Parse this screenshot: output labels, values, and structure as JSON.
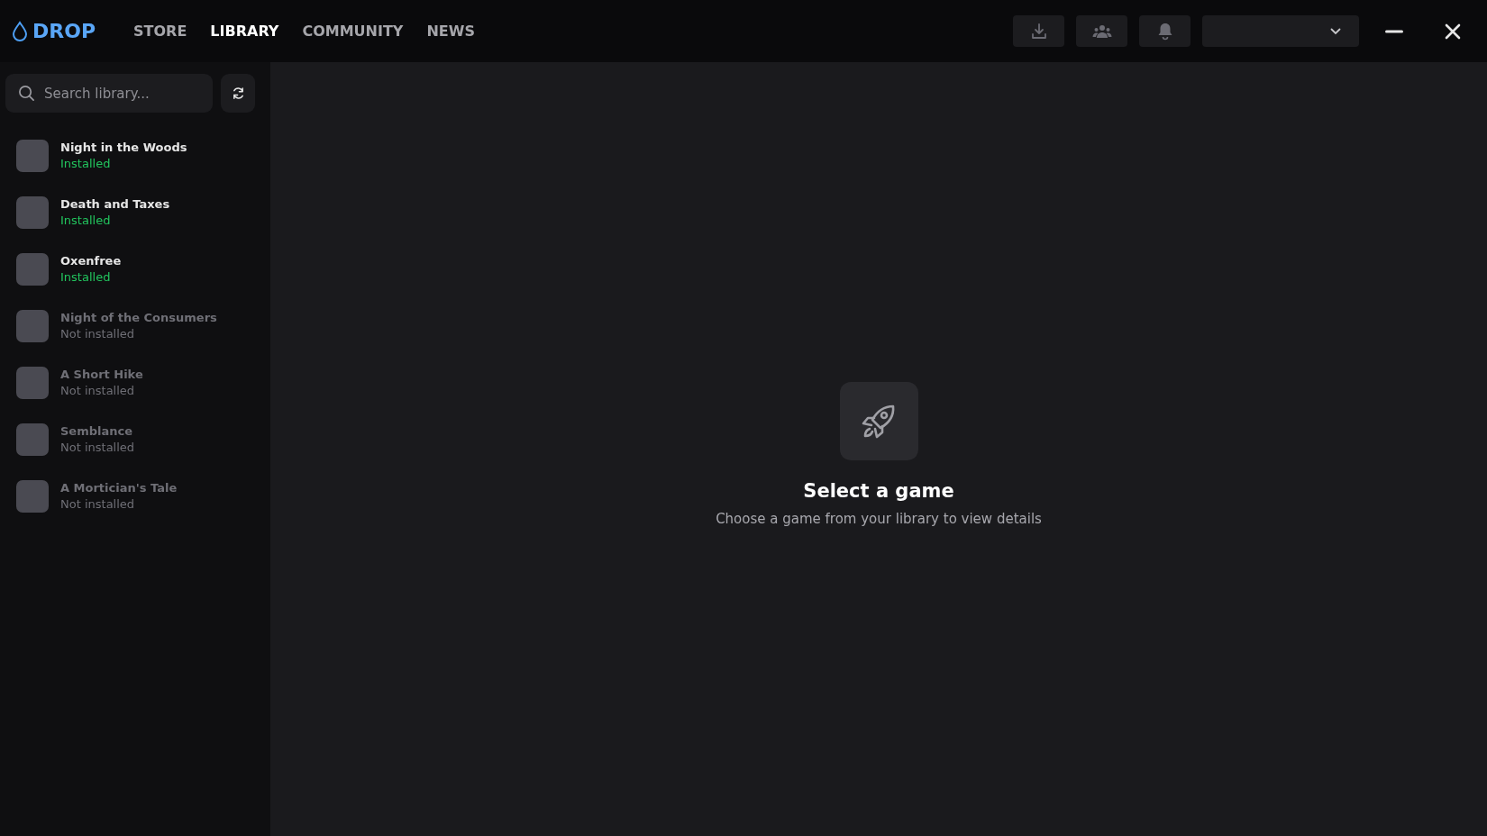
{
  "logo": {
    "text": "DROP"
  },
  "nav": [
    {
      "label": "STORE",
      "selected": false
    },
    {
      "label": "LIBRARY",
      "selected": true
    },
    {
      "label": "COMMUNITY",
      "selected": false
    },
    {
      "label": "NEWS",
      "selected": false
    }
  ],
  "search": {
    "placeholder": "Search library..."
  },
  "games": [
    {
      "title": "Night in the Woods",
      "status": "Installed",
      "installed": true
    },
    {
      "title": "Death and Taxes",
      "status": "Installed",
      "installed": true
    },
    {
      "title": "Oxenfree",
      "status": "Installed",
      "installed": true
    },
    {
      "title": "Night of the Consumers",
      "status": "Not installed",
      "installed": false
    },
    {
      "title": "A Short Hike",
      "status": "Not installed",
      "installed": false
    },
    {
      "title": "Semblance",
      "status": "Not installed",
      "installed": false
    },
    {
      "title": "A Mortician's Tale",
      "status": "Not installed",
      "installed": false
    }
  ],
  "empty_state": {
    "title": "Select a game",
    "subtitle": "Choose a game from your library to view details"
  }
}
